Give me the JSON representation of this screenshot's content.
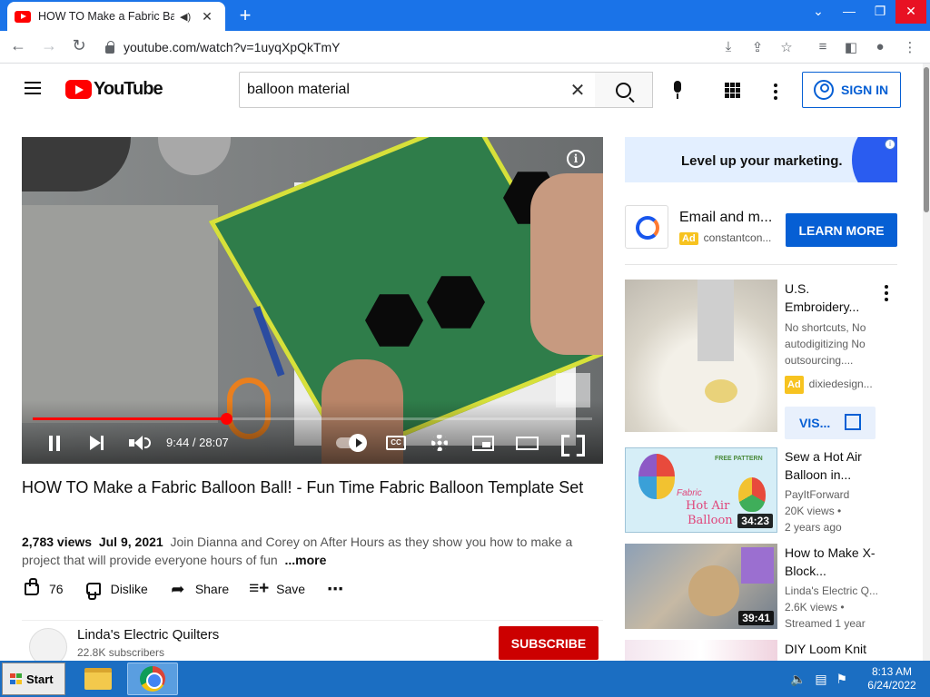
{
  "browser": {
    "tab_title": "HOW TO Make a Fabric Ballo",
    "url": "youtube.com/watch?v=1uyqXpQkTmY"
  },
  "youtube": {
    "logo_text": "YouTube",
    "search_query": "balloon material",
    "sign_in_label": "SIGN IN"
  },
  "player": {
    "time": "9:44 / 28:07",
    "progress_fraction": 0.346,
    "info_glyph": "i",
    "cc_label": "CC"
  },
  "video": {
    "title": "HOW TO Make a Fabric Balloon Ball! - Fun Time Fabric Balloon Template Set",
    "views": "2,783 views",
    "date": "Jul 9, 2021",
    "description": "Join Dianna and Corey on After Hours as they show you how to make a project that will provide everyone hours of fun",
    "more_label": "...more",
    "likes": "76",
    "dislike_label": "Dislike",
    "share_label": "Share",
    "save_label": "Save"
  },
  "channel": {
    "name": "Linda's Electric Quilters",
    "subscribers": "22.8K subscribers",
    "subscribe_label": "SUBSCRIBE"
  },
  "ads": {
    "banner_text": "Level up your marketing.",
    "promo_title": "Email and m...",
    "promo_badge": "Ad",
    "promo_advertiser": "constantcon...",
    "promo_button": "LEARN MORE"
  },
  "sidebar": {
    "ad_card": {
      "title": "U.S. Embroidery...",
      "description": "No shortcuts, No autodigitizing No outsourcing....",
      "badge": "Ad",
      "advertiser": "dixiedesign...",
      "visit_label": "VIS..."
    },
    "videos": [
      {
        "title": "Sew a Hot Air Balloon in...",
        "channel": "PayItForward",
        "views": "20K views •",
        "age": "2 years ago",
        "duration": "34:23",
        "thumb_text_1": "Fabric",
        "thumb_text_2": "Hot Air",
        "thumb_text_3": "Balloon",
        "thumb_text_4": "FREE PATTERN"
      },
      {
        "title": "How to Make X-Block...",
        "channel": "Linda's Electric Q...",
        "views": "2.6K views •",
        "age": "Streamed 1 year",
        "duration": "39:41"
      },
      {
        "title": "DIY Loom Knit"
      }
    ]
  },
  "taskbar": {
    "start_label": "Start",
    "time": "8:13 AM",
    "date": "6/24/2022"
  },
  "colors": {
    "tab_strip": "#1a73e8",
    "youtube_red": "#ff0000",
    "link_blue": "#065fd4",
    "taskbar": "#1b6ec2"
  }
}
